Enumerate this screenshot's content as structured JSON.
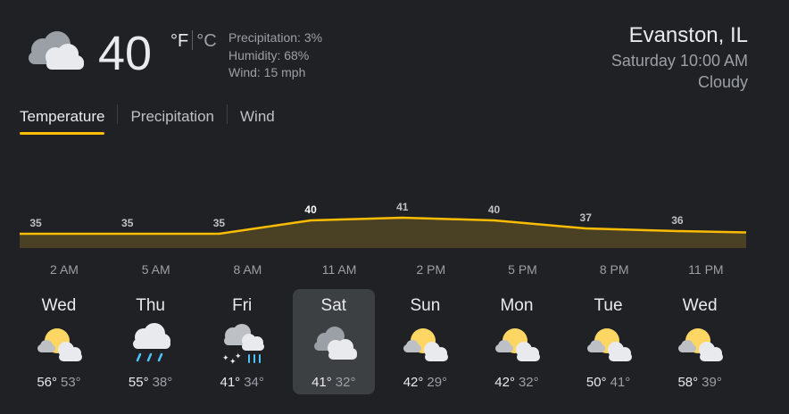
{
  "current": {
    "temperature": "40",
    "unit_f": "°F",
    "unit_c": "°C",
    "icon": "cloudy-icon",
    "precipitation": "Precipitation: 3%",
    "humidity": "Humidity: 68%",
    "wind": "Wind: 15 mph"
  },
  "location": {
    "name": "Evanston, IL",
    "time": "Saturday 10:00 AM",
    "condition": "Cloudy"
  },
  "tabs": [
    {
      "label": "Temperature",
      "active": true
    },
    {
      "label": "Precipitation",
      "active": false
    },
    {
      "label": "Wind",
      "active": false
    }
  ],
  "hourly": {
    "labels": [
      "2 AM",
      "5 AM",
      "8 AM",
      "11 AM",
      "2 PM",
      "5 PM",
      "8 PM",
      "11 PM"
    ],
    "values": [
      "35",
      "35",
      "35",
      "40",
      "41",
      "40",
      "37",
      "36"
    ],
    "current_index": 3
  },
  "colors": {
    "background": "#202124",
    "accent": "#fbbc04",
    "line": "#fbbc04",
    "fill": "#4a4024",
    "selected_day": "#3c4043"
  },
  "daily": [
    {
      "day": "Wed",
      "icon": "partly-cloudy-icon",
      "hi": "56°",
      "lo": "53°",
      "selected": false
    },
    {
      "day": "Thu",
      "icon": "rain-icon",
      "hi": "55°",
      "lo": "38°",
      "selected": false
    },
    {
      "day": "Fri",
      "icon": "rain-snow-icon",
      "hi": "41°",
      "lo": "34°",
      "selected": false
    },
    {
      "day": "Sat",
      "icon": "cloudy-icon",
      "hi": "41°",
      "lo": "32°",
      "selected": true
    },
    {
      "day": "Sun",
      "icon": "partly-cloudy-icon",
      "hi": "42°",
      "lo": "29°",
      "selected": false
    },
    {
      "day": "Mon",
      "icon": "partly-cloudy-icon",
      "hi": "42°",
      "lo": "32°",
      "selected": false
    },
    {
      "day": "Tue",
      "icon": "partly-cloudy-icon",
      "hi": "50°",
      "lo": "41°",
      "selected": false
    },
    {
      "day": "Wed",
      "icon": "partly-cloudy-icon",
      "hi": "58°",
      "lo": "39°",
      "selected": false
    }
  ]
}
